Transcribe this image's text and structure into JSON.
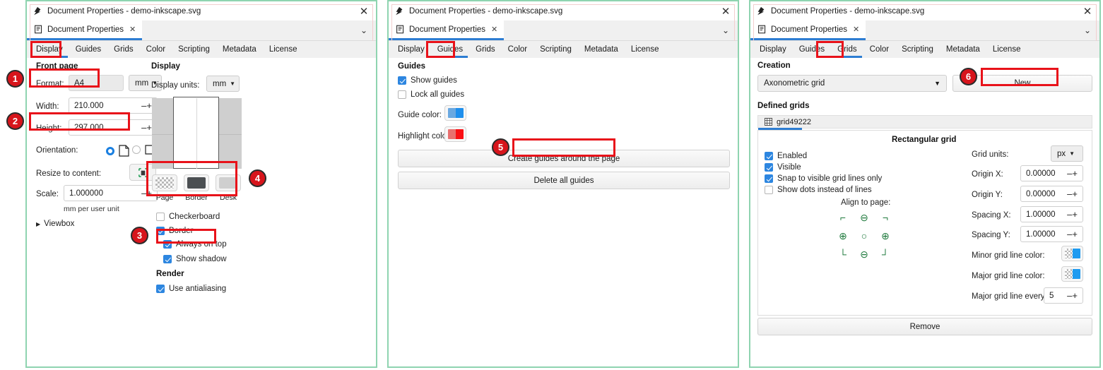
{
  "window": {
    "title": "Document Properties - demo-inkscape.svg",
    "tab_label": "Document Properties",
    "tab_close": "✕",
    "close_icon": "✕",
    "chevron_icon": "⌄"
  },
  "section_tabs": [
    "Display",
    "Guides",
    "Grids",
    "Color",
    "Scripting",
    "Metadata",
    "License"
  ],
  "panel1": {
    "active_tab": "Display",
    "front_page_heading": "Front page",
    "format_label": "Format:",
    "format_value": "A4",
    "format_units": "mm",
    "width_label": "Width:",
    "width_value": "210.000",
    "height_label": "Height:",
    "height_value": "297.000",
    "orientation_label": "Orientation:",
    "resize_label": "Resize to content:",
    "scale_label": "Scale:",
    "scale_value": "1.000000",
    "scale_sub": "mm per user unit",
    "viewbox_label": "Viewbox",
    "viewbox_arrow": "▶",
    "display_heading": "Display",
    "display_units_label": "Display units:",
    "display_units_value": "mm",
    "swatches": [
      "Page",
      "Border",
      "Desk"
    ],
    "checkboxes": [
      {
        "label": "Checkerboard",
        "checked": false,
        "indent": 0
      },
      {
        "label": "Border",
        "checked": true,
        "indent": 0
      },
      {
        "label": "Always on top",
        "checked": true,
        "indent": 1
      },
      {
        "label": "Show shadow",
        "checked": true,
        "indent": 1
      }
    ],
    "render_heading": "Render",
    "antialias_label": "Use antialiasing",
    "antialias_checked": true,
    "spin_minus": "–",
    "spin_plus": "+",
    "caret": "▼",
    "link_up": "ʌ",
    "link_down": "ʋ"
  },
  "panel2": {
    "active_tab": "Guides",
    "guides_heading": "Guides",
    "show_guides_label": "Show guides",
    "show_guides_checked": true,
    "lock_guides_label": "Lock all guides",
    "lock_guides_checked": false,
    "guide_color_label": "Guide color:",
    "guide_color": "#1f8fec",
    "highlight_color_label": "Highlight color:",
    "highlight_color": "#fa0f14",
    "create_guides_button": "Create guides around the page",
    "delete_guides_button": "Delete all guides"
  },
  "panel3": {
    "active_tab": "Grids",
    "creation_heading": "Creation",
    "creation_value": "Axonometric grid",
    "new_button": "New",
    "defined_grids_heading": "Defined grids",
    "grid_item": "grid49222",
    "grid_type_title": "Rectangular grid",
    "checkboxes": [
      {
        "label": "Enabled",
        "checked": true
      },
      {
        "label": "Visible",
        "checked": true
      },
      {
        "label": "Snap to visible grid lines only",
        "checked": true
      },
      {
        "label": "Show dots instead of lines",
        "checked": false
      }
    ],
    "align_label": "Align to page:",
    "align_glyphs": [
      "⌐",
      "⊖",
      "¬",
      "⊕",
      "○",
      "⊕",
      "└",
      "⊖",
      "┘"
    ],
    "fields": [
      {
        "label": "Grid units:",
        "value": "px",
        "kind": "combo"
      },
      {
        "label": "Origin X:",
        "value": "0.00000",
        "kind": "spin"
      },
      {
        "label": "Origin Y:",
        "value": "0.00000",
        "kind": "spin"
      },
      {
        "label": "Spacing X:",
        "value": "1.00000",
        "kind": "spin"
      },
      {
        "label": "Spacing Y:",
        "value": "1.00000",
        "kind": "spin"
      }
    ],
    "minor_color_label": "Minor grid line color:",
    "minor_color": "#1f9bf0",
    "major_color_label": "Major grid line color:",
    "major_color": "#1f9bf0",
    "major_every_label": "Major grid line every:",
    "major_every_value": "5",
    "remove_button": "Remove"
  },
  "annotations": {
    "badges": [
      "1",
      "2",
      "3",
      "4",
      "5",
      "6"
    ],
    "box_color": "#e8121a",
    "badge_color": "#d7151c"
  }
}
